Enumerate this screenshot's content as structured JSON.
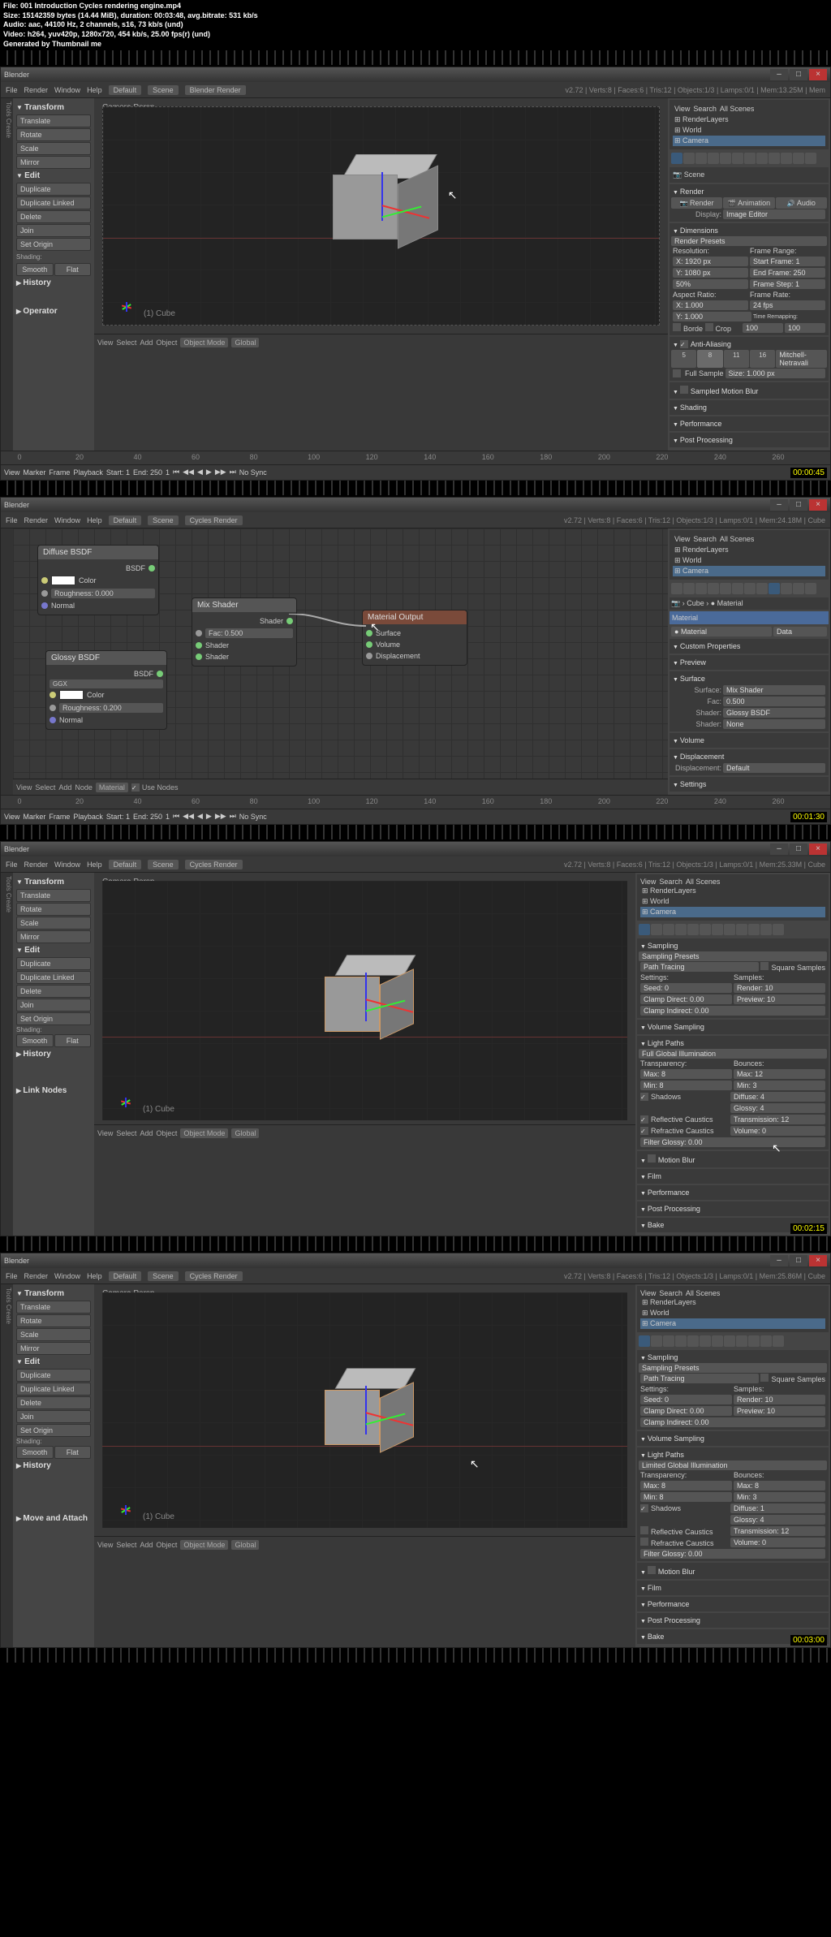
{
  "file_info": {
    "file": "File: 001 Introduction Cycles rendering engine.mp4",
    "size": "Size: 15142359 bytes (14.44 MiB), duration: 00:03:48, avg.bitrate: 531 kb/s",
    "audio": "Audio: aac, 44100 Hz, 2 channels, s16, 73 kb/s (und)",
    "video": "Video: h264, yuv420p, 1280x720, 454 kb/s, 25.00 fps(r) (und)",
    "generated": "Generated by Thumbnail me"
  },
  "timestamps": [
    "00:00:45",
    "00:01:30",
    "00:02:15",
    "00:03:00"
  ],
  "titlebar": "Blender",
  "menu": {
    "items": [
      "File",
      "Render",
      "Window",
      "Help"
    ],
    "layout": "Default",
    "scene": "Scene",
    "renderer1": "Blender Render",
    "renderer2": "Cycles Render",
    "version": "v2.72",
    "stats1": "Verts:8 | Faces:6 | Tris:12 | Objects:1/3 | Lamps:0/1 | Mem:13.25M | Mem",
    "stats2": "Verts:8 | Faces:6 | Tris:12 | Objects:1/3 | Lamps:0/1 | Mem:24.18M | Cube",
    "stats3": "Verts:8 | Faces:6 | Tris:12 | Objects:1/3 | Lamps:0/1 | Mem:25.33M | Cube",
    "stats4": "Verts:8 | Faces:6 | Tris:12 | Objects:1/3 | Lamps:0/1 | Mem:25.86M | Cube"
  },
  "transform": {
    "header": "Transform",
    "translate": "Translate",
    "rotate": "Rotate",
    "scale": "Scale",
    "mirror": "Mirror"
  },
  "edit": {
    "header": "Edit",
    "duplicate": "Duplicate",
    "duplicate_linked": "Duplicate Linked",
    "delete": "Delete",
    "join": "Join",
    "set_origin": "Set Origin",
    "shading": "Shading:",
    "smooth": "Smooth",
    "flat": "Flat"
  },
  "history": "History",
  "operator": "Operator",
  "link_nodes": "Link Nodes",
  "move_attach": "Move and Attach",
  "viewport": {
    "label": "Camera Persp",
    "cube_label": "(1) Cube",
    "view": "View",
    "select": "Select",
    "add": "Add",
    "object": "Object",
    "node": "Node",
    "object_mode": "Object Mode",
    "global": "Global",
    "material": "Material",
    "use_nodes": "Use Nodes"
  },
  "outliner": {
    "view": "View",
    "search": "Search",
    "all_scenes": "All Scenes",
    "render_layers": "RenderLayers",
    "world": "World",
    "camera": "Camera",
    "cube": "Cube",
    "material": "Material"
  },
  "render_props": {
    "scene": "Scene",
    "render_header": "Render",
    "render": "Render",
    "animation": "Animation",
    "audio": "Audio",
    "display": "Display:",
    "image_editor": "Image Editor",
    "dimensions": "Dimensions",
    "render_presets": "Render Presets",
    "resolution": "Resolution:",
    "x": "X:",
    "y": "Y:",
    "x_val": "1920 px",
    "y_val": "1080 px",
    "percent": "50%",
    "frame_range": "Frame Range:",
    "start_frame": "Start Frame:",
    "end_frame": "End Frame:",
    "frame_step": "Frame Step:",
    "start_val": "1",
    "end_val": "250",
    "step_val": "1",
    "aspect_ratio": "Aspect Ratio:",
    "aspect_x": "1.000",
    "aspect_y": "1.000",
    "frame_rate": "Frame Rate:",
    "fps": "24 fps",
    "time_remapping": "Time Remapping:",
    "remap_old": "100",
    "remap_new": "100",
    "border": "Borde",
    "crop": "Crop",
    "anti_aliasing": "Anti-Aliasing",
    "aa5": "5",
    "aa8": "8",
    "aa11": "11",
    "aa16": "16",
    "mitchell": "Mitchell-Netravali",
    "full_sample": "Full Sample",
    "size": "Size:",
    "size_val": "1.000 px",
    "sampled_motion_blur": "Sampled Motion Blur",
    "shading": "Shading",
    "performance": "Performance",
    "post_processing": "Post Processing"
  },
  "material_props": {
    "cube": "Cube",
    "material": "Material",
    "data": "Data",
    "custom_props": "Custom Properties",
    "preview": "Preview",
    "surface": "Surface",
    "surface_label": "Surface:",
    "mix_shader": "Mix Shader",
    "fac": "Fac:",
    "fac_val": "0.500",
    "shader": "Shader:",
    "glossy_bsdf": "Glossy BSDF",
    "none": "None",
    "volume": "Volume",
    "displacement": "Displacement",
    "displacement_label": "Displacement:",
    "default": "Default",
    "settings": "Settings"
  },
  "sampling_props": {
    "sampling": "Sampling",
    "sampling_presets": "Sampling Presets",
    "path_tracing": "Path Tracing",
    "square_samples": "Square Samples",
    "settings": "Settings:",
    "samples": "Samples:",
    "seed": "Seed:",
    "seed_val": "0",
    "render": "Render:",
    "render_val": "10",
    "clamp_direct": "Clamp Direct:",
    "clamp_direct_val": "0.00",
    "preview": "Preview:",
    "preview_val": "10",
    "clamp_indirect": "Clamp Indirect:",
    "clamp_indirect_val": "0.00",
    "volume_sampling": "Volume Sampling",
    "light_paths": "Light Paths",
    "full_global": "Full Global Illumination",
    "limited_global": "Limited Global Illumination",
    "transparency": "Transparency:",
    "bounces": "Bounces:",
    "max": "Max:",
    "min": "Min:",
    "max_t": "8",
    "min_t": "8",
    "max_b": "12",
    "min_b": "3",
    "min_b4": "8",
    "diffuse": "Diffuse:",
    "glossy": "Glossy:",
    "transmission": "Transmission:",
    "volume": "Volume:",
    "diffuse_val": "4",
    "glossy_val": "4",
    "transmission_val": "12",
    "volume_val": "0",
    "diffuse_val4": "1",
    "shadows": "Shadows",
    "reflective_caustics": "Reflective Caustics",
    "refractive_caustics": "Refractive Caustics",
    "filter_glossy": "Filter Glossy:",
    "filter_glossy_val": "0.00",
    "motion_blur": "Motion Blur",
    "film": "Film",
    "performance": "Performance",
    "post_processing": "Post Processing",
    "bake": "Bake"
  },
  "nodes": {
    "diffuse": "Diffuse BSDF",
    "glossy": "Glossy BSDF",
    "mix": "Mix Shader",
    "output": "Material Output",
    "bsdf": "BSDF",
    "color": "Color",
    "roughness": "Roughness:",
    "roughness_val1": "0.000",
    "roughness_val2": "0.200",
    "normal": "Normal",
    "ggx": "GGX",
    "shader": "Shader",
    "fac": "Fac:",
    "fac_val": "0.500",
    "surface": "Surface",
    "volume": "Volume",
    "displacement": "Displacement"
  },
  "timeline": {
    "view": "View",
    "marker": "Marker",
    "frame": "Frame",
    "playback": "Playback",
    "start": "Start:",
    "start_val": "1",
    "end": "End:",
    "end_val": "250",
    "current": "1",
    "no_sync": "No Sync",
    "marks": [
      "0",
      "20",
      "40",
      "60",
      "80",
      "100",
      "120",
      "140",
      "160",
      "180",
      "200",
      "220",
      "240",
      "260"
    ]
  }
}
